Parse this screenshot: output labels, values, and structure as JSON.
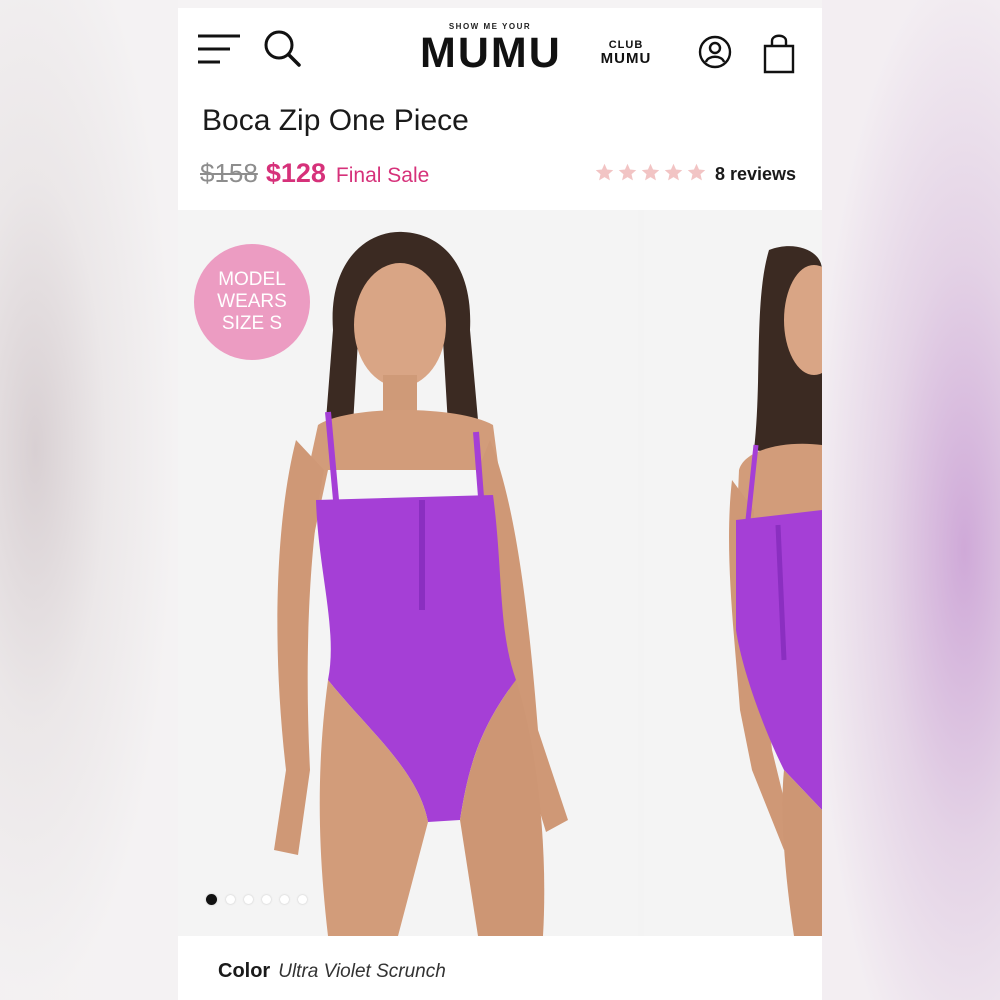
{
  "header": {
    "logo_small": "SHOW ME YOUR",
    "logo_big": "MUMU",
    "club_line1": "CLUB",
    "club_line2": "MUMU",
    "icons": [
      "menu-icon",
      "search-icon",
      "account-icon",
      "bag-icon"
    ]
  },
  "product": {
    "title": "Boca Zip One Piece",
    "old_price": "$158",
    "new_price": "$128",
    "sale_label": "Final Sale",
    "rating_stars": 5,
    "reviews_label": "8 reviews"
  },
  "gallery": {
    "badge": "MODEL WEARS SIZE S",
    "dot_count": 6,
    "active_dot": 0
  },
  "color": {
    "label": "Color",
    "value": "Ultra Violet Scrunch"
  },
  "colors": {
    "accent": "#d6317a",
    "badge": "#ec9cc2",
    "swimsuit": "#a53fd6",
    "star": "#f2c4c4"
  }
}
